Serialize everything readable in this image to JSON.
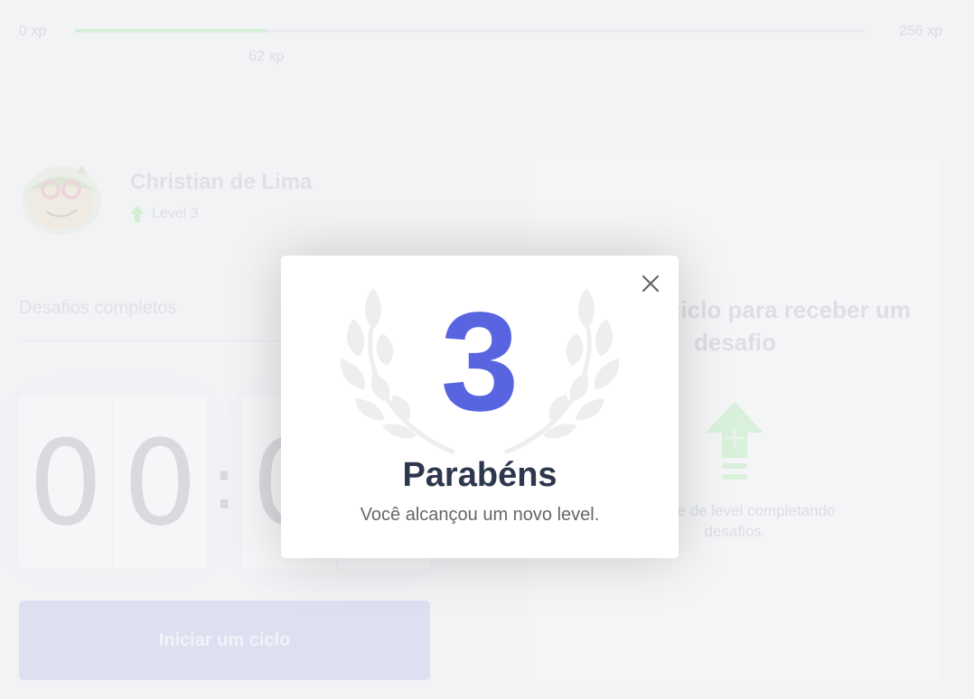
{
  "xp": {
    "min_label": "0 xp",
    "max_label": "256 xp",
    "current_label": "62 xp",
    "progress_fraction": 0.242
  },
  "profile": {
    "name": "Christian de Lima",
    "level_label": "Level 3"
  },
  "challenges": {
    "label": "Desafios completos"
  },
  "countdown": {
    "minute_left": "0",
    "minute_right": "0",
    "separator": ":",
    "second_left": "0"
  },
  "start_button": {
    "label": "Iniciar um ciclo"
  },
  "challenge_card": {
    "title": "Inicie um ciclo para receber um desafio",
    "hint": "Avance de level completando desafios."
  },
  "modal": {
    "level": "3",
    "title": "Parabéns",
    "subtitle": "Você alcançou um novo level."
  },
  "colors": {
    "accent": "#5965e0",
    "xp_fill": "#4cd62b",
    "title": "#2e384d",
    "level_up": "#4cd62b"
  },
  "icons": {
    "close": "close-icon",
    "level_up": "level-up-icon",
    "laurel": "laurel-icon"
  }
}
